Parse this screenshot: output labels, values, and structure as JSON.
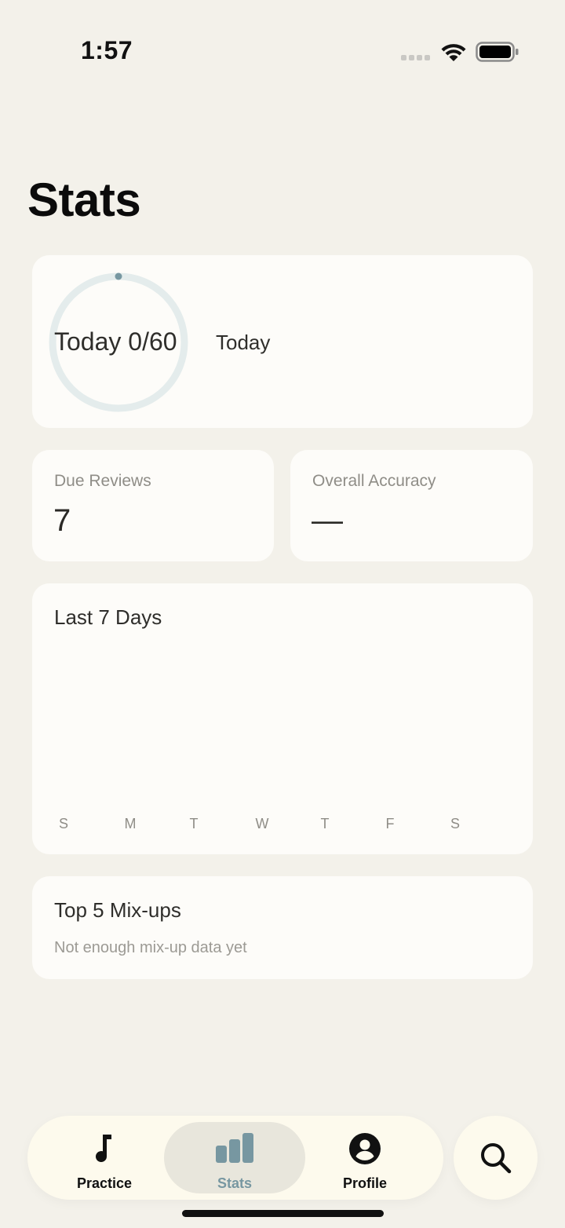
{
  "status_bar": {
    "time": "1:57"
  },
  "page": {
    "title": "Stats"
  },
  "today": {
    "ring_label": "Today 0/60",
    "side_label": "Today",
    "progress": 0
  },
  "due_reviews": {
    "label": "Due Reviews",
    "value": "7"
  },
  "accuracy": {
    "label": "Overall Accuracy",
    "value": "—"
  },
  "weekly": {
    "title": "Last 7 Days"
  },
  "chart_data": {
    "type": "bar",
    "title": "Last 7 Days",
    "categories": [
      "S",
      "M",
      "T",
      "W",
      "T",
      "F",
      "S"
    ],
    "values": [
      0,
      0,
      0,
      0,
      0,
      0,
      0
    ]
  },
  "mixups": {
    "title": "Top 5 Mix-ups",
    "empty": "Not enough mix-up data yet"
  },
  "tabs": [
    {
      "label": "Practice",
      "icon": "music-note-icon"
    },
    {
      "label": "Stats",
      "icon": "bar-chart-icon"
    },
    {
      "label": "Profile",
      "icon": "person-circle-icon"
    }
  ],
  "colors": {
    "accent": "#7797a1",
    "ring_track": "#e4ecec",
    "background": "#f3f1ea"
  }
}
